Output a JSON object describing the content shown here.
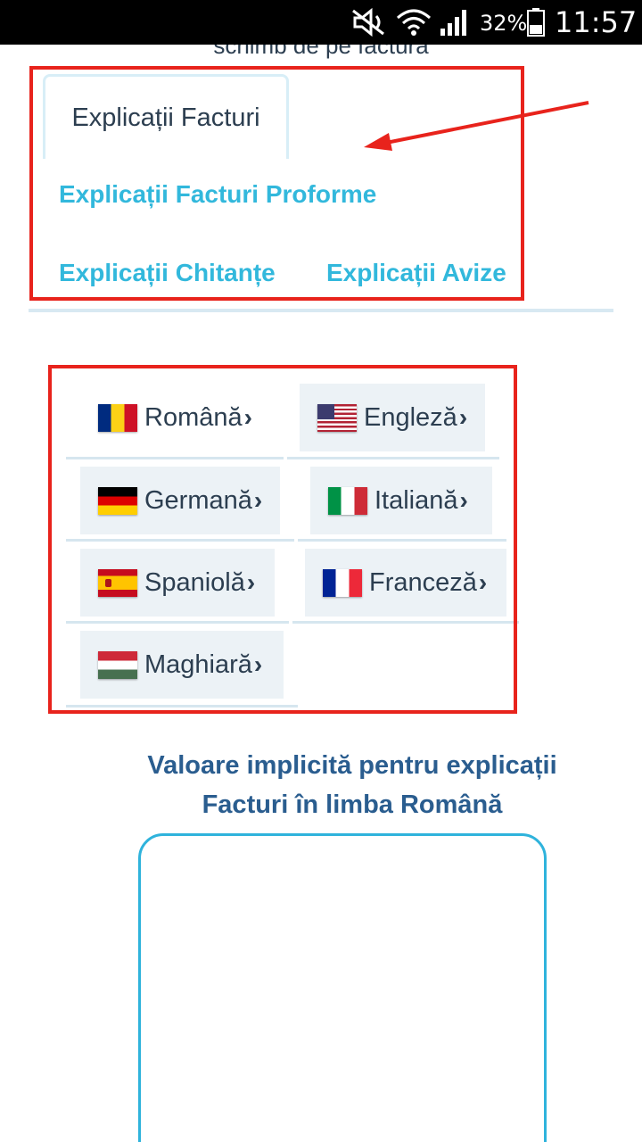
{
  "status_bar": {
    "battery_percent": "32%",
    "time": "11:57",
    "icons": [
      "mute-icon",
      "wifi-icon",
      "signal-icon",
      "battery-icon"
    ]
  },
  "header": {
    "cutoff_text": "schimb de pe factură"
  },
  "tabs": [
    {
      "label": "Explicații Facturi",
      "active": true
    },
    {
      "label": "Explicații Facturi Proforme",
      "active": false
    },
    {
      "label": "Explicații Chitanțe",
      "active": false
    },
    {
      "label": "Explicații Avize",
      "active": false
    }
  ],
  "languages": [
    {
      "label": "Română",
      "flag": "flag-romania-icon"
    },
    {
      "label": "Engleză",
      "flag": "flag-usa-icon"
    },
    {
      "label": "Germană",
      "flag": "flag-germany-icon"
    },
    {
      "label": "Italiană",
      "flag": "flag-italy-icon"
    },
    {
      "label": "Spaniolă",
      "flag": "flag-spain-icon"
    },
    {
      "label": "Franceză",
      "flag": "flag-france-icon"
    },
    {
      "label": "Maghiară",
      "flag": "flag-hungary-icon"
    }
  ],
  "chevron": "›",
  "default_value": {
    "heading_line1": "Valoare implicită pentru explicații",
    "heading_line2": "Facturi în limba Română",
    "text": ""
  },
  "colors": {
    "annotation_red": "#e8231c",
    "link_cyan": "#32b8dc",
    "heading_blue": "#2a5d8f",
    "textarea_border": "#2fb3dc"
  }
}
